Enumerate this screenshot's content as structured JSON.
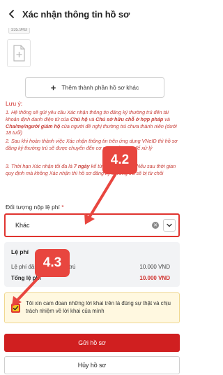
{
  "header": {
    "title": "Xác nhận thông tin hồ sơ"
  },
  "upload": {
    "file_size": "335.9KB",
    "add_button_label": "Thêm thành phần hồ sơ khác"
  },
  "notes": {
    "title": "Lưu ý:",
    "items": [
      {
        "p1": "1. Hệ thống sẽ gửi yêu cầu Xác nhận thông tin đăng ký thường trú đến tài khoản định danh điện tử của ",
        "b1": "Chủ hộ",
        "p2": " và ",
        "b2": "Chủ sở hữu chỗ ở hợp pháp",
        "p3": " và ",
        "b3": "Cha/mẹ/người giám hộ",
        "p4": " của người đề nghị thường trú chưa thành niên (dưới 18 tuổi)"
      },
      {
        "p1": "2. Sau khi hoàn thành việc Xác nhận thông tin trên ứng dụng VNeID thì hồ sơ đăng ký thường trú sẽ được chuyển đến cơ quan công an để xử lý"
      },
      {
        "p1": "3. Thời hạn Xác nhận tối đa là ",
        "b1": "7 ngày",
        "p2": " kể từ khi nộp hồ sơ. Nếu sau thời gian quy định mà không Xác nhận thì hồ sơ đăng ký thường trú sẽ bị từ chối"
      }
    ]
  },
  "fee_subject": {
    "label": "Đối tượng nộp lệ phí",
    "required_mark": "*",
    "value": "Khác"
  },
  "fee": {
    "title": "Lệ phí",
    "rows": [
      {
        "label": "Lệ phí đăng ký thường trú",
        "value": "10.000 VND"
      },
      {
        "label": "Tổng lệ phí",
        "value": "10.000 VND"
      }
    ]
  },
  "commitment": {
    "text": "Tôi xin cam đoan những lời khai trên là đúng sự thật và chịu trách nhiệm về lời khai của mình",
    "checked": true
  },
  "actions": {
    "submit": "Gửi hồ sơ",
    "cancel": "Hủy hồ sơ"
  },
  "annotations": {
    "step_a": "4.2",
    "step_b": "4.3",
    "color": "#e8463f"
  },
  "colors": {
    "primary_red": "#d01f20",
    "warning_bg": "#fff8e0",
    "checkbox_yellow": "#f3c622"
  }
}
